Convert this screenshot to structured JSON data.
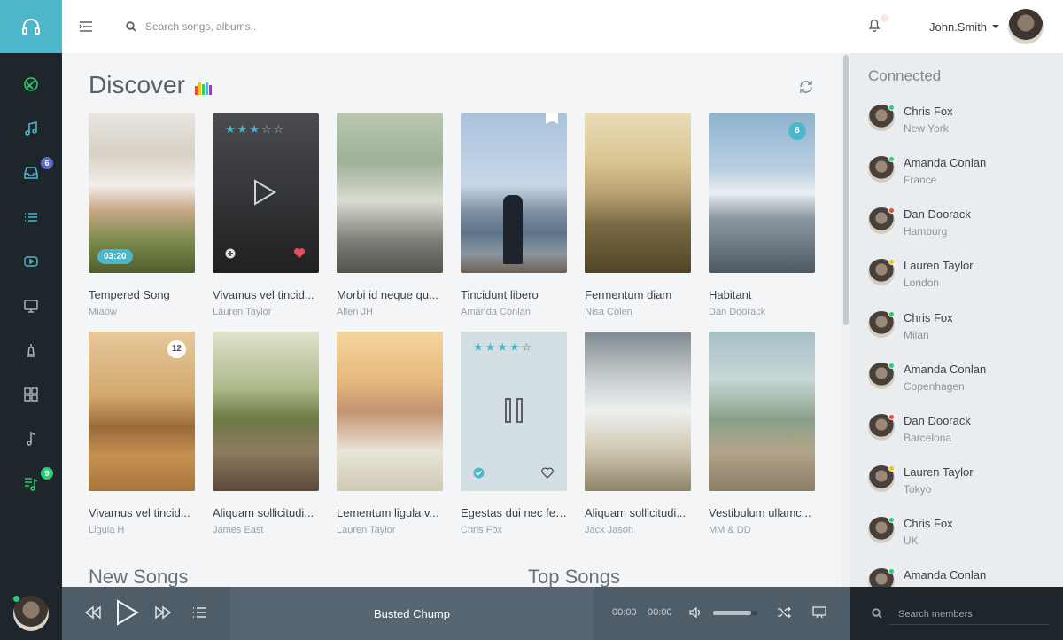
{
  "colors": {
    "accent": "#4cb6cb",
    "sidebar": "#1e252b",
    "player": "#4f5d69",
    "green": "#2ecc71",
    "red": "#e74c3c",
    "yellow": "#f1c40f"
  },
  "topbar": {
    "search_placeholder": "Search songs, albums..",
    "username": "John.Smith"
  },
  "sidebar": {
    "items": [
      {
        "icon": "compass-icon",
        "color": "#2ecc71",
        "badge": ""
      },
      {
        "icon": "music-note-icon",
        "color": "#4cb6cb",
        "badge": ""
      },
      {
        "icon": "inbox-icon",
        "color": "#4cb6cb",
        "badge": "6",
        "badge_color": "#5b6bc0"
      },
      {
        "icon": "list-icon",
        "color": "#4cb6cb",
        "badge": ""
      },
      {
        "icon": "youtube-icon",
        "color": "#4cb6cb",
        "badge": ""
      },
      {
        "icon": "desktop-icon",
        "color": "#aab4bc",
        "badge": ""
      },
      {
        "icon": "trophy-icon",
        "color": "#aab4bc",
        "badge": ""
      },
      {
        "icon": "grid-icon",
        "color": "#aab4bc",
        "badge": ""
      },
      {
        "icon": "note-icon",
        "color": "#aab4bc",
        "badge": ""
      },
      {
        "icon": "playlist-icon",
        "color": "#2ecc71",
        "badge": "9",
        "badge_color": "#2ecc71"
      }
    ]
  },
  "discover": {
    "title": "Discover",
    "cards": [
      {
        "title": "Tempered Song",
        "artist": "Miaow",
        "time": "03:20"
      },
      {
        "title": "Vivamus vel tincid...",
        "artist": "Lauren Taylor",
        "rating": 3
      },
      {
        "title": "Morbi id neque qu...",
        "artist": "Allen JH"
      },
      {
        "title": "Tincidunt libero",
        "artist": "Amanda Conlan"
      },
      {
        "title": "Fermentum diam",
        "artist": "Nisa Colen"
      },
      {
        "title": "Habitant",
        "artist": "Dan Doorack",
        "count": "6"
      },
      {
        "title": "Vivamus vel tincid...",
        "artist": "Ligula H",
        "count": "12"
      },
      {
        "title": "Aliquam sollicitudi...",
        "artist": "James East"
      },
      {
        "title": "Lementum ligula v...",
        "artist": "Lauren Taylor"
      },
      {
        "title": "Egestas dui nec fer...",
        "artist": "Chris Fox",
        "rating": 4
      },
      {
        "title": "Aliquam sollicitudi...",
        "artist": "Jack Jason"
      },
      {
        "title": "Vestibulum ullamc...",
        "artist": "MM & DD"
      }
    ]
  },
  "sections": {
    "new_songs": "New Songs",
    "top_songs": "Top Songs"
  },
  "connected": {
    "title": "Connected",
    "members": [
      {
        "name": "Chris Fox",
        "location": "New York",
        "status": "green"
      },
      {
        "name": "Amanda Conlan",
        "location": "France",
        "status": "green"
      },
      {
        "name": "Dan Doorack",
        "location": "Hamburg",
        "status": "red"
      },
      {
        "name": "Lauren Taylor",
        "location": "London",
        "status": "yellow"
      },
      {
        "name": "Chris Fox",
        "location": "Milan",
        "status": "green"
      },
      {
        "name": "Amanda Conlan",
        "location": "Copenhagen",
        "status": "green"
      },
      {
        "name": "Dan Doorack",
        "location": "Barcelona",
        "status": "red"
      },
      {
        "name": "Lauren Taylor",
        "location": "Tokyo",
        "status": "yellow"
      },
      {
        "name": "Chris Fox",
        "location": "UK",
        "status": "green"
      },
      {
        "name": "Amanda Conlan",
        "location": "",
        "status": "green"
      }
    ]
  },
  "player": {
    "track": "Busted Chump",
    "current_time": "00:00",
    "duration": "00:00",
    "volume": 0.85
  },
  "member_search": {
    "placeholder": "Search members"
  }
}
